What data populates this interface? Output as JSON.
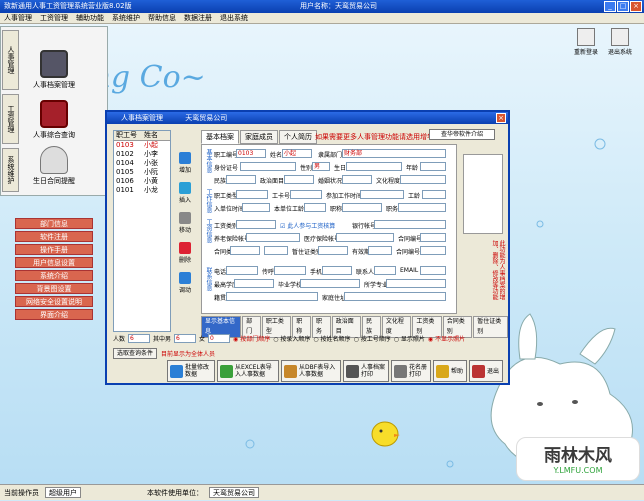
{
  "app": {
    "title": "致新通用人事工资管理系统营业版8.02版",
    "user_label": "用户名称：天鸾贸易公司",
    "win_minimize": "_",
    "win_maximize": "□",
    "win_close": "×"
  },
  "menu": [
    "人事管理",
    "工资管理",
    "辅助功能",
    "系统维护",
    "帮助信息",
    "数据注册",
    "退出系统"
  ],
  "sidebar": {
    "tabs": [
      "人事管理",
      "工资管理",
      "系统维护"
    ],
    "icons": [
      {
        "label": "人事档案管理",
        "icon": "personnel-file-icon"
      },
      {
        "label": "人事综合查询",
        "icon": "book-query-icon"
      },
      {
        "label": "生日合同提醒",
        "icon": "bell-icon"
      }
    ],
    "buttons": [
      "部门信息",
      "软件注册",
      "操作手册",
      "用户信息设置",
      "系统介绍",
      "背景图设置",
      "网络安全设置说明",
      "界面介绍"
    ]
  },
  "toolbar_right": [
    {
      "label": "重新登录",
      "icon": "relogin-icon"
    },
    {
      "label": "退出系统",
      "icon": "exit-icon"
    }
  ],
  "background": {
    "logo_text": "ing Co~"
  },
  "dialog": {
    "title": "人事档案管理",
    "company": "天鸾贸易公司",
    "close": "×",
    "list_headers": [
      "职工号",
      "姓名"
    ],
    "employees": [
      {
        "id": "0103",
        "name": "小起",
        "selected": true
      },
      {
        "id": "0102",
        "name": "小李",
        "selected": false
      },
      {
        "id": "0104",
        "name": "小张",
        "selected": false
      },
      {
        "id": "0105",
        "name": "小阮",
        "selected": false
      },
      {
        "id": "0106",
        "name": "小黄",
        "selected": false
      },
      {
        "id": "0101",
        "name": "小龙",
        "selected": false
      }
    ],
    "side_buttons": [
      "增加",
      "插入",
      "移动",
      "删除",
      "调动"
    ],
    "tabs": [
      "基本档案",
      "家庭成员",
      "个人简历"
    ],
    "tip": "如果需要更多人事管理功能请选用增华帝",
    "soft_intro": "查华帝软件介绍",
    "side_note": "此功能为人事档案的增加、删除、修改等功能",
    "sections": {
      "basic": "基本信息",
      "work": "工作信息",
      "pay": "工资信息",
      "contact": "联系信息"
    },
    "fields": {
      "emp_no": "职工编号",
      "emp_no_val": "0103",
      "name": "姓名",
      "name_val": "小起",
      "dept": "隶属部门",
      "dept_val": "财务部",
      "id_card": "身份证号",
      "gender": "性别",
      "gender_val": "男",
      "birthday": "生日",
      "age": "年龄",
      "ethnic": "民族",
      "political": "政治面目",
      "marital": "婚姻状况",
      "education": "文化程度",
      "job_type": "职工类型",
      "job_card": "工卡号",
      "work_date": "参加工作时间",
      "seniority": "工龄",
      "entry_date": "入单位时间",
      "company_seniority": "本单位工龄",
      "title": "职称",
      "position": "职务",
      "pay_type": "工资类别",
      "in_pay": "此人参与工资核算",
      "bank": "银行帐号",
      "pension": "养老保险帐号",
      "medical": "医疗保险帐号",
      "contract_no": "合同编号",
      "contract_type": "合同类",
      "temp_type": "暂住证类别",
      "expiry": "有效期",
      "phone": "电话",
      "pager": "传呼",
      "mobile": "手机",
      "contact": "联系人",
      "email": "EMAIL",
      "speciality": "最高学历",
      "school": "毕业学校",
      "major": "所学专业",
      "native": "籍贯",
      "address": "家庭住址"
    },
    "bottom_tabs": [
      "显示基本信息",
      "部门",
      "职工类型",
      "职称",
      "职务",
      "政治面目",
      "民族",
      "文化程度",
      "工资类别",
      "合同类别",
      "暂住证类别"
    ],
    "counts": {
      "total_label": "人数",
      "total": "6",
      "male_label": "其中男",
      "male": "6",
      "female_label": "女",
      "female": "0"
    },
    "sort_options": [
      "按部门顺序",
      "按录入顺序",
      "按姓名顺序",
      "按工号顺序"
    ],
    "photo_options": [
      "显示照片",
      "不显示照片"
    ],
    "query_btn": "选取查询条件",
    "query_note": "目前显示为全体人员",
    "actions": [
      {
        "label": "批量修改数据",
        "icon": "batch-edit-icon",
        "color": "#2b7fd6"
      },
      {
        "label": "从EXCEL表导入人事数据",
        "icon": "excel-import-icon",
        "color": "#3aa03a"
      },
      {
        "label": "从DBF表导入人事数据",
        "icon": "dbf-import-icon",
        "color": "#c7872a"
      },
      {
        "label": "人事档案打印",
        "icon": "print-icon",
        "color": "#555"
      },
      {
        "label": "花名册打印",
        "icon": "roster-print-icon",
        "color": "#777"
      },
      {
        "label": "帮助",
        "icon": "help-icon",
        "color": "#d9a81a"
      },
      {
        "label": "退出",
        "icon": "exit-door-icon",
        "color": "#b33"
      }
    ]
  },
  "status": {
    "operator_label": "当前操作员",
    "operator": "超级用户",
    "company_label": "本软件使用单位：",
    "company": "天鸾贸易公司"
  },
  "watermark": {
    "big": "雨林木风",
    "small": "Y.LMFU.COM"
  }
}
